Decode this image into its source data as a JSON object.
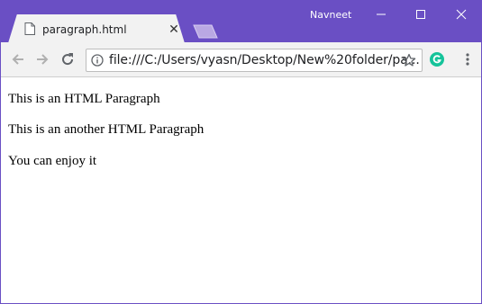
{
  "window": {
    "user_name": "Navneet",
    "controls": {
      "minimize": "minimize",
      "maximize": "maximize",
      "close": "close"
    }
  },
  "tabs": [
    {
      "title": "paragraph.html",
      "icon": "page-icon",
      "active": true
    }
  ],
  "toolbar": {
    "back_icon": "back-arrow-icon",
    "forward_icon": "forward-arrow-icon",
    "reload_icon": "reload-icon",
    "url": "file:///C:/Users/vyasn/Desktop/New%20folder/pa..."
  },
  "content": {
    "paragraphs": [
      "This is an HTML Paragraph",
      "This is an another HTML Paragraph",
      "You can enjoy it"
    ]
  },
  "colors": {
    "frame": "#6a4fc4",
    "toolbar": "#f2f2f2",
    "extension": "#15c39a"
  }
}
